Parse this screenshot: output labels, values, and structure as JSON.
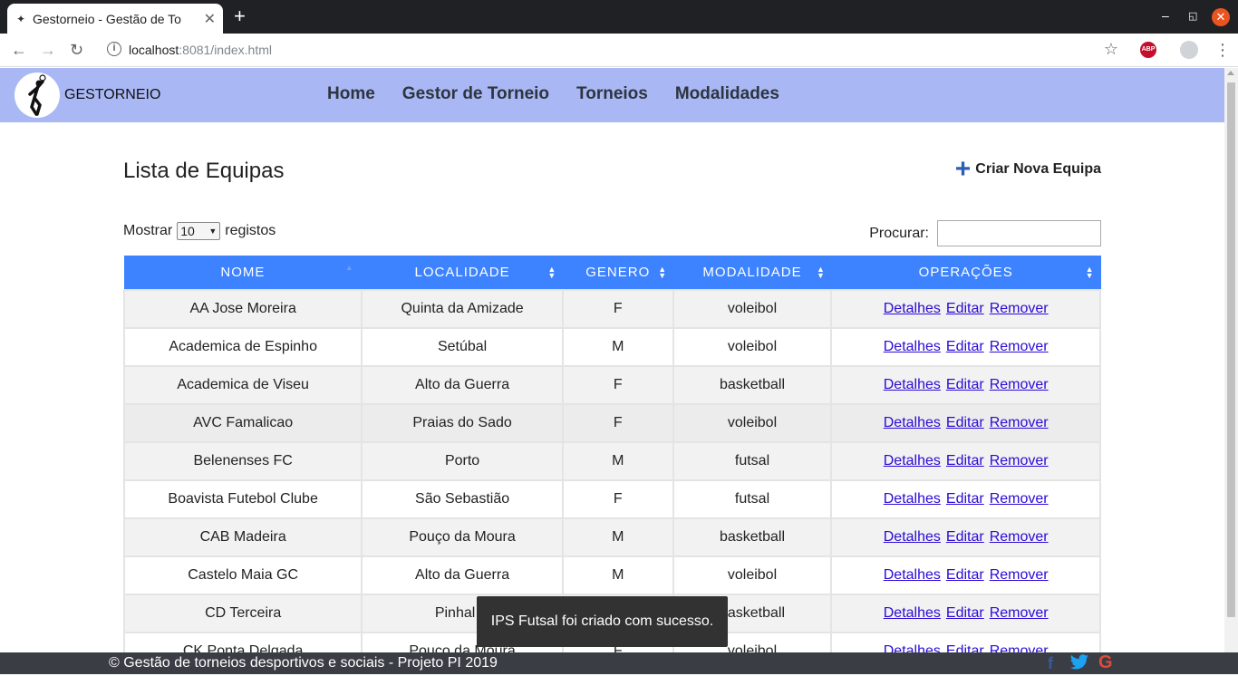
{
  "browser": {
    "tab_title": "Gestorneio - Gestão de To",
    "tab_favicon": "running-person-icon",
    "url_host": "localhost",
    "url_rest": ":8081/index.html",
    "abp_label": "ABP"
  },
  "navbar": {
    "brand": "GESTORNEIO",
    "links": [
      "Home",
      "Gestor de Torneio",
      "Torneios",
      "Modalidades"
    ],
    "bg_color": "#a9b8f4"
  },
  "main": {
    "title": "Lista de Equipas",
    "create_label": "Criar Nova Equipa",
    "length_prefix": "Mostrar",
    "length_value": "10",
    "length_suffix": "registos",
    "search_label": "Procurar:"
  },
  "table": {
    "header_color": "#3d82ff",
    "columns": [
      "NOME",
      "LOCALIDADE",
      "GENERO",
      "MODALIDADE",
      "OPERAÇÕES"
    ],
    "actions": [
      "Detalhes",
      "Editar",
      "Remover"
    ],
    "rows": [
      {
        "nome": "AA Jose Moreira",
        "localidade": "Quinta da Amizade",
        "genero": "F",
        "modalidade": "voleibol"
      },
      {
        "nome": "Academica de Espinho",
        "localidade": "Setúbal",
        "genero": "M",
        "modalidade": "voleibol"
      },
      {
        "nome": "Academica de Viseu",
        "localidade": "Alto da Guerra",
        "genero": "F",
        "modalidade": "basketball"
      },
      {
        "nome": "AVC Famalicao",
        "localidade": "Praias do Sado",
        "genero": "F",
        "modalidade": "voleibol"
      },
      {
        "nome": "Belenenses FC",
        "localidade": "Porto",
        "genero": "M",
        "modalidade": "futsal"
      },
      {
        "nome": "Boavista Futebol Clube",
        "localidade": "São Sebastião",
        "genero": "F",
        "modalidade": "futsal"
      },
      {
        "nome": "CAB Madeira",
        "localidade": "Pouço da Moura",
        "genero": "M",
        "modalidade": "basketball"
      },
      {
        "nome": "Castelo Maia GC",
        "localidade": "Alto da Guerra",
        "genero": "M",
        "modalidade": "voleibol"
      },
      {
        "nome": "CD Terceira",
        "localidade": "Pinhal N",
        "genero": "",
        "modalidade": "basketball"
      },
      {
        "nome": "CK Ponta Delgada",
        "localidade": "Pouço da Moura",
        "genero": "F",
        "modalidade": "voleibol"
      }
    ]
  },
  "toast": {
    "message": "IPS Futsal foi criado com sucesso."
  },
  "footer": {
    "copyright": "© Gestão de torneios desportivos e sociais - Projeto PI 2019",
    "social": [
      "facebook-icon",
      "twitter-icon",
      "google-icon"
    ]
  }
}
